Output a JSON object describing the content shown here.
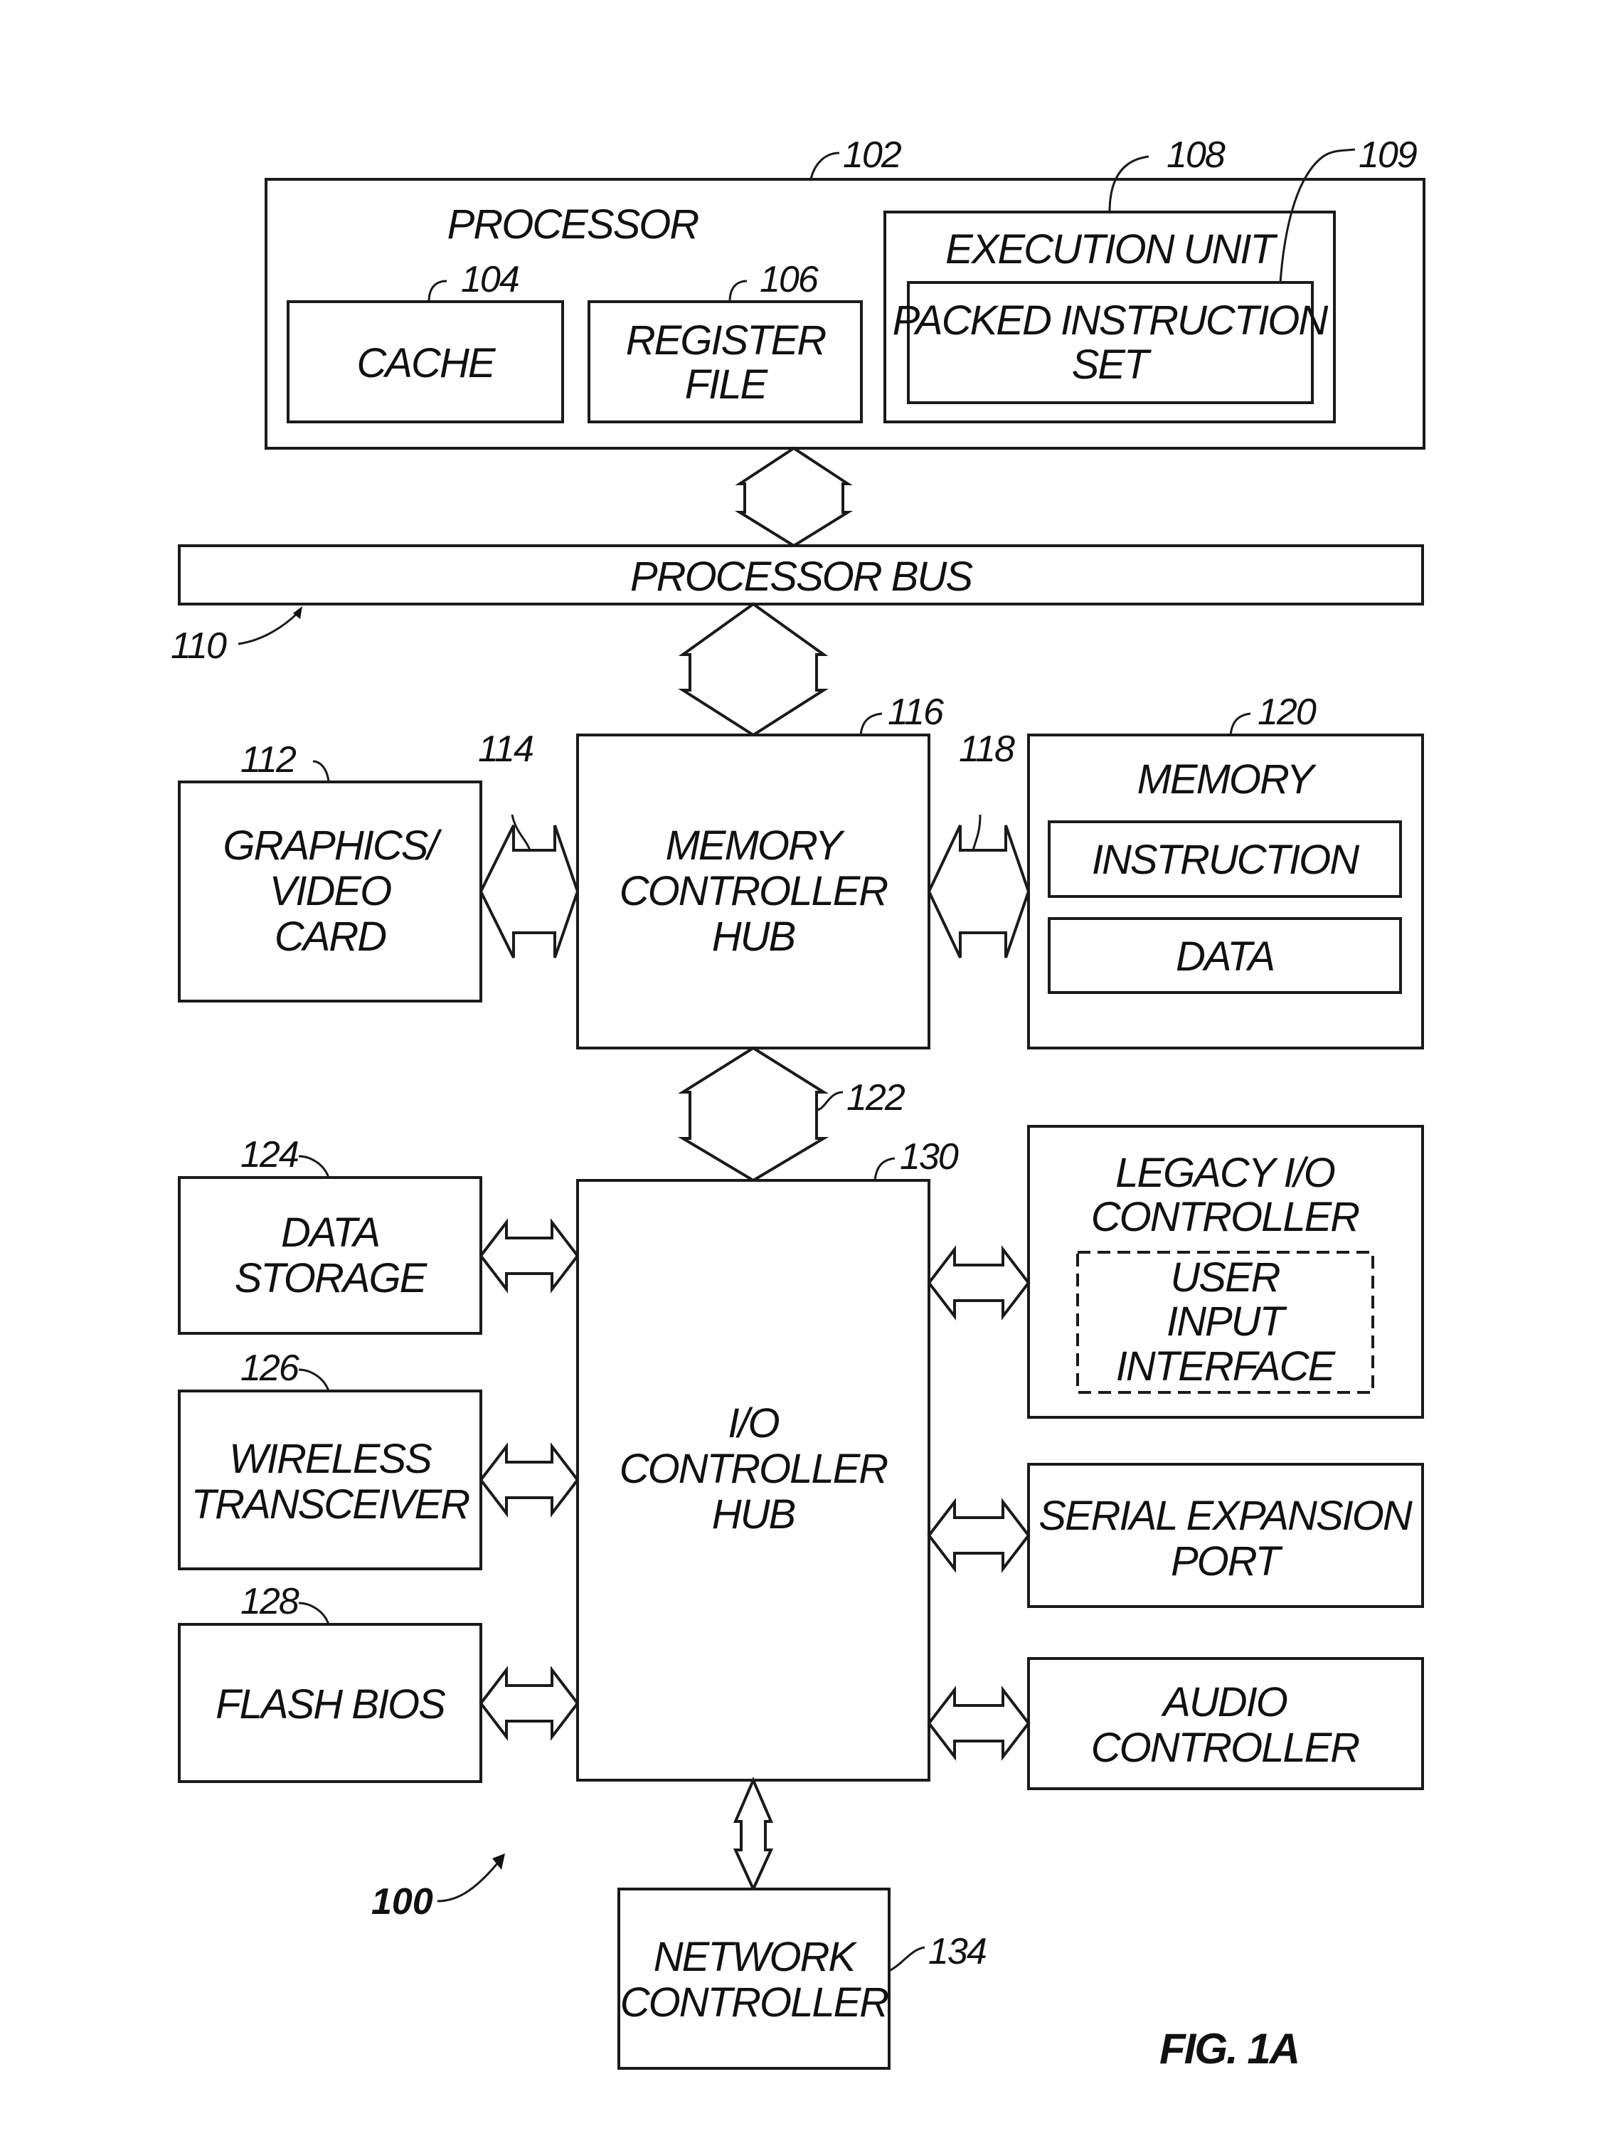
{
  "figure": {
    "label": "FIG. 1A",
    "system_ref": "100"
  },
  "blocks": {
    "processor": {
      "label": "PROCESSOR",
      "ref": "102"
    },
    "cache": {
      "label_lines": [
        "CACHE"
      ],
      "ref": "104"
    },
    "register_file": {
      "label_lines": [
        "REGISTER",
        "FILE"
      ],
      "ref": "106"
    },
    "execution_unit": {
      "label": "EXECUTION UNIT",
      "ref": "108"
    },
    "packed_instruction_set": {
      "label_lines": [
        "PACKED INSTRUCTION",
        "SET"
      ],
      "ref": "109"
    },
    "processor_bus": {
      "label": "PROCESSOR BUS",
      "ref": "110"
    },
    "graphics_video_card": {
      "label_lines": [
        "GRAPHICS/",
        "VIDEO",
        "CARD"
      ],
      "ref": "112"
    },
    "graphics_link": {
      "ref": "114"
    },
    "memory_controller_hub": {
      "label_lines": [
        "MEMORY",
        "CONTROLLER",
        "HUB"
      ],
      "ref": "116"
    },
    "memory_link": {
      "ref": "118"
    },
    "memory": {
      "label": "MEMORY",
      "ref": "120",
      "items": [
        "INSTRUCTION",
        "DATA"
      ]
    },
    "hub_link": {
      "ref": "122"
    },
    "data_storage": {
      "label_lines": [
        "DATA",
        "STORAGE"
      ],
      "ref": "124"
    },
    "wireless_transceiver": {
      "label_lines": [
        "WIRELESS",
        "TRANSCEIVER"
      ],
      "ref": "126"
    },
    "flash_bios": {
      "label_lines": [
        "FLASH BIOS"
      ],
      "ref": "128"
    },
    "io_controller_hub": {
      "label_lines": [
        "I/O",
        "CONTROLLER",
        "HUB"
      ],
      "ref": "130"
    },
    "legacy_io_controller": {
      "label_lines": [
        "LEGACY I/O",
        "CONTROLLER"
      ]
    },
    "user_input_interface": {
      "label_lines": [
        "USER",
        "INPUT",
        "INTERFACE"
      ]
    },
    "serial_expansion_port": {
      "label_lines": [
        "SERIAL EXPANSION",
        "PORT"
      ]
    },
    "audio_controller": {
      "label_lines": [
        "AUDIO",
        "CONTROLLER"
      ]
    },
    "network_controller": {
      "label_lines": [
        "NETWORK",
        "CONTROLLER"
      ],
      "ref": "134"
    }
  }
}
